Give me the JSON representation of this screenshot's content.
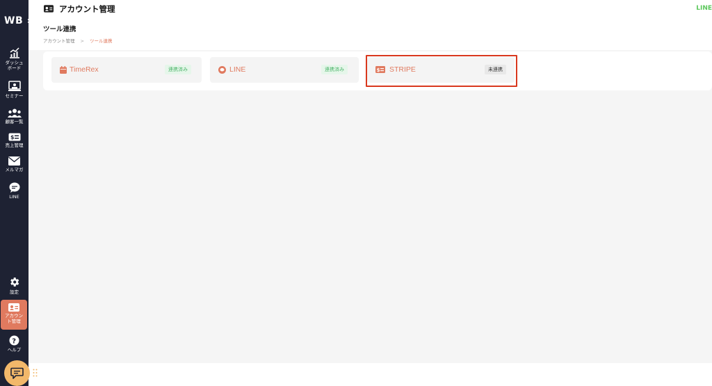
{
  "sidebar": {
    "logo": "WB",
    "expand_glyph": "»",
    "items": [
      {
        "label": "ダッシュボード",
        "icon": "chart-icon"
      },
      {
        "label": "セミナー",
        "icon": "presentation-icon"
      },
      {
        "label": "顧客一覧",
        "icon": "users-icon"
      },
      {
        "label": "売上管理",
        "icon": "money-icon"
      },
      {
        "label": "メルマガ",
        "icon": "envelope-icon"
      },
      {
        "label": "LINE",
        "icon": "chat-bubble-icon"
      }
    ],
    "bottom_items": [
      {
        "label": "設定",
        "icon": "gear-icon"
      },
      {
        "label": "アカウント管理",
        "icon": "id-card-icon",
        "active": true
      },
      {
        "label": "ヘルプ",
        "icon": "help-icon"
      }
    ]
  },
  "header": {
    "title": "アカウント管理",
    "right_text": "LINE"
  },
  "page": {
    "title": "ツール連携",
    "breadcrumb": {
      "parent": "アカウント管理",
      "separator": ">",
      "current": "ツール連携"
    }
  },
  "tools": [
    {
      "name": "TimeRex",
      "status": "連携済み",
      "icon": "calendar-icon"
    },
    {
      "name": "LINE",
      "status": "連携済み",
      "icon": "line-icon"
    },
    {
      "name": "STRIPE",
      "status": "未連携",
      "icon": "money-card-icon"
    }
  ],
  "colors": {
    "sidebar_bg": "#1e2233",
    "accent": "#e07a5f",
    "linked_badge_text": "#4cb56a",
    "highlight_border": "#d9381e",
    "chat_button": "#f2b86a"
  }
}
